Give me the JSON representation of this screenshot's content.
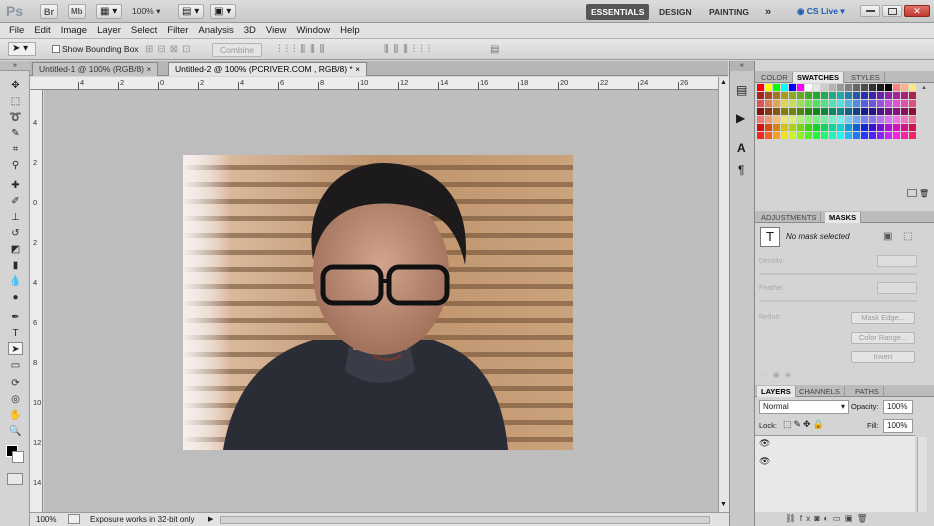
{
  "app": {
    "logo": "Ps",
    "zoom": "100%",
    "cslive": "CS Live"
  },
  "workspaces": {
    "essentials": "ESSENTIALS",
    "design": "DESIGN",
    "painting": "PAINTING",
    "more": "»"
  },
  "menus": [
    "File",
    "Edit",
    "Image",
    "Layer",
    "Select",
    "Filter",
    "Analysis",
    "3D",
    "View",
    "Window",
    "Help"
  ],
  "options": {
    "show_bounding_box": "Show Bounding Box",
    "combine": "Combine"
  },
  "docs": {
    "tab1": "Untitled-1 @ 100% (RGB/8)",
    "tab2": "Untitled-2 @ 100% (PCRIVER.COM , RGB/8) *"
  },
  "ruler_h": [
    "4",
    "2",
    "0",
    "2",
    "4",
    "6",
    "8",
    "10",
    "12",
    "14",
    "16",
    "18",
    "20",
    "22",
    "24",
    "26"
  ],
  "ruler_v": [
    "4",
    "2",
    "0",
    "2",
    "4",
    "6",
    "8",
    "10",
    "12",
    "14"
  ],
  "status": {
    "zoom": "100%",
    "info": "Exposure works in 32-bit only"
  },
  "panels": {
    "color_tabs": {
      "color": "COLOR",
      "swatches": "SWATCHES",
      "styles": "STYLES"
    },
    "adj_tabs": {
      "adjustments": "ADJUSTMENTS",
      "masks": "MASKS"
    },
    "masks": {
      "no_mask": "No mask selected",
      "density": "Density:",
      "feather": "Feather:",
      "refine": "Refine:",
      "mask_edge": "Mask Edge...",
      "color_range": "Color Range...",
      "invert": "Invert"
    },
    "layer_tabs": {
      "layers": "LAYERS",
      "channels": "CHANNELS",
      "paths": "PATHS"
    },
    "layers": {
      "blend": "Normal",
      "opacity_label": "Opacity:",
      "opacity": "100%",
      "lock_label": "Lock:",
      "fill_label": "Fill:",
      "fill": "100%"
    }
  },
  "colors": {
    "canvas_bg": "#bdbdbd",
    "panel_bg": "#d4d4d4",
    "active_workspace": "#555555"
  }
}
